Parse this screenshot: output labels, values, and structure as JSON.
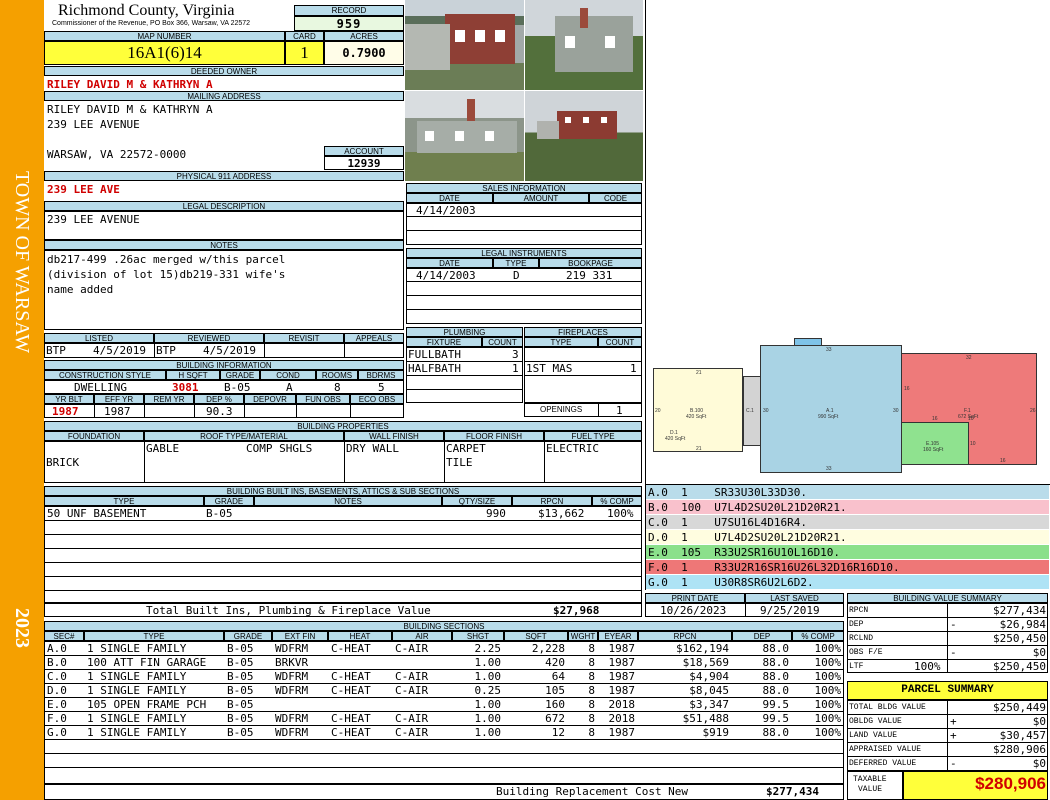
{
  "sidebar": {
    "town": "TOWN OF WARSAW",
    "year": "2023"
  },
  "header": {
    "county": "Richmond County, Virginia",
    "commissioner": "Commissioner of the Revenue, PO Box 366, Warsaw, VA 22572"
  },
  "record": {
    "label": "RECORD",
    "value": "959"
  },
  "map": {
    "label": "MAP NUMBER",
    "value": "16A1(6)14"
  },
  "card": {
    "label": "CARD",
    "value": "1"
  },
  "acres": {
    "label": "ACRES",
    "value": "0.7900"
  },
  "owner": {
    "label": "DEEDED OWNER",
    "value": "RILEY DAVID M & KATHRYN A"
  },
  "mailing": {
    "label": "MAILING ADDRESS",
    "line1": "RILEY DAVID M & KATHRYN A",
    "line2": "239 LEE AVENUE",
    "line3": "WARSAW, VA 22572-0000"
  },
  "account": {
    "label": "ACCOUNT",
    "value": "12939"
  },
  "address911": {
    "label": "PHYSICAL 911 ADDRESS",
    "value": "239 LEE AVE"
  },
  "legal": {
    "label": "LEGAL DESCRIPTION",
    "value": "239 LEE AVENUE"
  },
  "notes": {
    "label": "NOTES",
    "line1": "db217-499 .26ac merged w/this parcel",
    "line2": "(division of lot 15)db219-331 wife's",
    "line3": "name added"
  },
  "listing": {
    "h_listed": "LISTED",
    "h_reviewed": "REVIEWED",
    "h_revisit": "REVISIT",
    "h_appeals": "APPEALS",
    "listed_by": "BTP",
    "listed_date": "4/5/2019",
    "reviewed_by": "BTP",
    "reviewed_date": "4/5/2019"
  },
  "building_info": {
    "label": "BUILDING INFORMATION",
    "h_style": "CONSTRUCTION STYLE",
    "h_sqft": "H SQFT",
    "h_grade": "GRADE",
    "h_cond": "COND",
    "h_rooms": "ROOMS",
    "h_bdrms": "BDRMS",
    "style": "DWELLING",
    "sqft": "3081",
    "grade": "B-05",
    "cond": "A",
    "rooms": "8",
    "bdrms": "5",
    "h_yrblt": "YR BLT",
    "h_effyr": "EFF YR",
    "h_remyr": "REM YR",
    "h_dep": "DEP %",
    "h_depovr": "DEPOVR",
    "h_funobs": "FUN OBS",
    "h_ecoobs": "ECO OBS",
    "yrblt": "1987",
    "effyr": "1987",
    "dep": "90.3"
  },
  "properties": {
    "label": "BUILDING PROPERTIES",
    "h_foundation": "FOUNDATION",
    "h_roof": "ROOF TYPE/MATERIAL",
    "h_wall": "WALL FINISH",
    "h_floor": "FLOOR FINISH",
    "h_fuel": "FUEL TYPE",
    "foundation": "BRICK",
    "roof_type": "GABLE",
    "roof_material": "COMP SHGLS",
    "wall": "DRY WALL",
    "floor1": "CARPET",
    "floor2": "TILE",
    "fuel": "ELECTRIC"
  },
  "builtins": {
    "label": "BUILDING BUILT INS, BASEMENTS, ATTICS & SUB SECTIONS",
    "headers": [
      "TYPE",
      "GRADE",
      "NOTES",
      "QTY/SIZE",
      "RPCN",
      "% COMP"
    ],
    "rows": [
      {
        "type": "50 UNF BASEMENT",
        "grade": "B-05",
        "notes": "",
        "qty": "990",
        "rpcn": "$13,662",
        "comp": "100%"
      }
    ],
    "total_label": "Total Built Ins, Plumbing & Fireplace Value",
    "total_value": "$27,968"
  },
  "sales": {
    "label": "SALES INFORMATION",
    "h_date": "DATE",
    "h_amount": "AMOUNT",
    "h_code": "CODE",
    "date": "4/14/2003"
  },
  "instruments": {
    "label": "LEGAL INSTRUMENTS",
    "h_date": "DATE",
    "h_type": "TYPE",
    "h_bookpage": "BOOKPAGE",
    "date": "4/14/2003",
    "type": "D",
    "bookpage": "219 331"
  },
  "plumbing": {
    "label": "PLUMBING",
    "h_fixture": "FIXTURE",
    "h_count": "COUNT",
    "rows": [
      {
        "fixture": "FULLBATH",
        "count": "3"
      },
      {
        "fixture": "HALFBATH",
        "count": "1"
      }
    ]
  },
  "fireplaces": {
    "label": "FIREPLACES",
    "h_type": "TYPE",
    "h_count": "COUNT",
    "type": "1ST MAS",
    "count": "1",
    "openings_label": "OPENINGS",
    "openings": "1"
  },
  "sketch": {
    "labels": {
      "a_name": "A.1",
      "a_area": "990 SqFt",
      "b_name": "B.100",
      "b_area": "420 SqFt",
      "c_name": "C.1",
      "d_name": "D.1",
      "d_area": "420 SqFt",
      "e_name": "E.105",
      "e_area": "160 SqFt",
      "f_name": "F.1",
      "f_area": "672 SqFt",
      "n33top": "33",
      "n33bot": "33",
      "n30l": "30",
      "n30r": "30",
      "n21t": "21",
      "n21b": "21",
      "n20": "20",
      "n32": "32",
      "n16": "16",
      "n26": "26",
      "n10a": "10",
      "n16b": "16",
      "n16c": "16",
      "n10b": "10"
    },
    "colors": {
      "a": "#a9d3e4",
      "b": "#fff7d6",
      "c": "#d3d3d3",
      "e": "#8fe28f",
      "f": "#ee7a7a",
      "tab": "#7fc3e8"
    }
  },
  "segments": [
    {
      "text": "A.0  1    SR33U30L33D30.",
      "color": "#b9dcea"
    },
    {
      "text": "B.0  100  U7L4D2SU20L21D20R21.",
      "color": "#f9c1cc"
    },
    {
      "text": "C.0  1    U7SU16L4D16R4.",
      "color": "#d8d8d8"
    },
    {
      "text": "D.0  1    U7L4D2SU20L21D20R21.",
      "color": "#fffde0"
    },
    {
      "text": "E.0  105  R33U2SR16U10L16D10.",
      "color": "#8be08b"
    },
    {
      "text": "F.0  1    R33U2R16SR16U26L32D16R16D10.",
      "color": "#ee7777"
    },
    {
      "text": "G.0  1    U30R8SR6U2L6D2.",
      "color": "#aee3f5"
    }
  ],
  "dates": {
    "h_print": "PRINT DATE",
    "h_saved": "LAST SAVED",
    "print": "10/26/2023",
    "saved": "9/25/2019"
  },
  "bvs": {
    "label": "BUILDING VALUE SUMMARY",
    "rows": [
      {
        "label": "RPCN",
        "sign": "",
        "value": "$277,434"
      },
      {
        "label": "DEP",
        "sign": "-",
        "value": "$26,984"
      },
      {
        "label": "RCLND",
        "sign": "",
        "value": "$250,450"
      },
      {
        "label": "OBS F/E",
        "sign": "-",
        "value": "$0"
      },
      {
        "label": "LTF",
        "pct": "100%",
        "sign": "",
        "value": "$250,450"
      }
    ]
  },
  "sections": {
    "label": "BUILDING SECTIONS",
    "headers": [
      "SEC#",
      "TYPE",
      "GRADE",
      "EXT FIN",
      "HEAT",
      "AIR",
      "SHGT",
      "SQFT",
      "WGHT",
      "EYEAR",
      "RPCN",
      "DEP",
      "% COMP"
    ],
    "rows": [
      [
        "A.0",
        "1 SINGLE FAMILY",
        "B-05",
        "WDFRM",
        "C-HEAT",
        "C-AIR",
        "2.25",
        "2,228",
        "8",
        "1987",
        "$162,194",
        "88.0",
        "100%"
      ],
      [
        "B.0",
        "100 ATT FIN GARAGE",
        "B-05",
        "BRKVR",
        "",
        "",
        "1.00",
        "420",
        "8",
        "1987",
        "$18,569",
        "88.0",
        "100%"
      ],
      [
        "C.0",
        "1 SINGLE FAMILY",
        "B-05",
        "WDFRM",
        "C-HEAT",
        "C-AIR",
        "1.00",
        "64",
        "8",
        "1987",
        "$4,904",
        "88.0",
        "100%"
      ],
      [
        "D.0",
        "1 SINGLE FAMILY",
        "B-05",
        "WDFRM",
        "C-HEAT",
        "C-AIR",
        "0.25",
        "105",
        "8",
        "1987",
        "$8,045",
        "88.0",
        "100%"
      ],
      [
        "E.0",
        "105 OPEN FRAME PCH",
        "B-05",
        "",
        "",
        "",
        "1.00",
        "160",
        "8",
        "2018",
        "$3,347",
        "99.5",
        "100%"
      ],
      [
        "F.0",
        "1 SINGLE FAMILY",
        "B-05",
        "WDFRM",
        "C-HEAT",
        "C-AIR",
        "1.00",
        "672",
        "8",
        "2018",
        "$51,488",
        "99.5",
        "100%"
      ],
      [
        "G.0",
        "1 SINGLE FAMILY",
        "B-05",
        "WDFRM",
        "C-HEAT",
        "C-AIR",
        "1.00",
        "12",
        "8",
        "1987",
        "$919",
        "88.0",
        "100%"
      ]
    ],
    "total_label": "Building Replacement Cost New",
    "total_value": "$277,434"
  },
  "parcel": {
    "label": "PARCEL SUMMARY",
    "rows": [
      {
        "label": "TOTAL BLDG VALUE",
        "sign": "",
        "value": "$250,449"
      },
      {
        "label": "OBLDG VALUE",
        "sign": "+",
        "value": "$0"
      },
      {
        "label": "LAND VALUE",
        "sign": "+",
        "value": "$30,457"
      },
      {
        "label": "APPRAISED VALUE",
        "sign": "",
        "value": "$280,906"
      },
      {
        "label": "DEFERRED VALUE",
        "sign": "-",
        "value": "$0"
      }
    ],
    "taxable_label1": "TAXABLE",
    "taxable_label2": "VALUE",
    "taxable_value": "$280,906"
  }
}
